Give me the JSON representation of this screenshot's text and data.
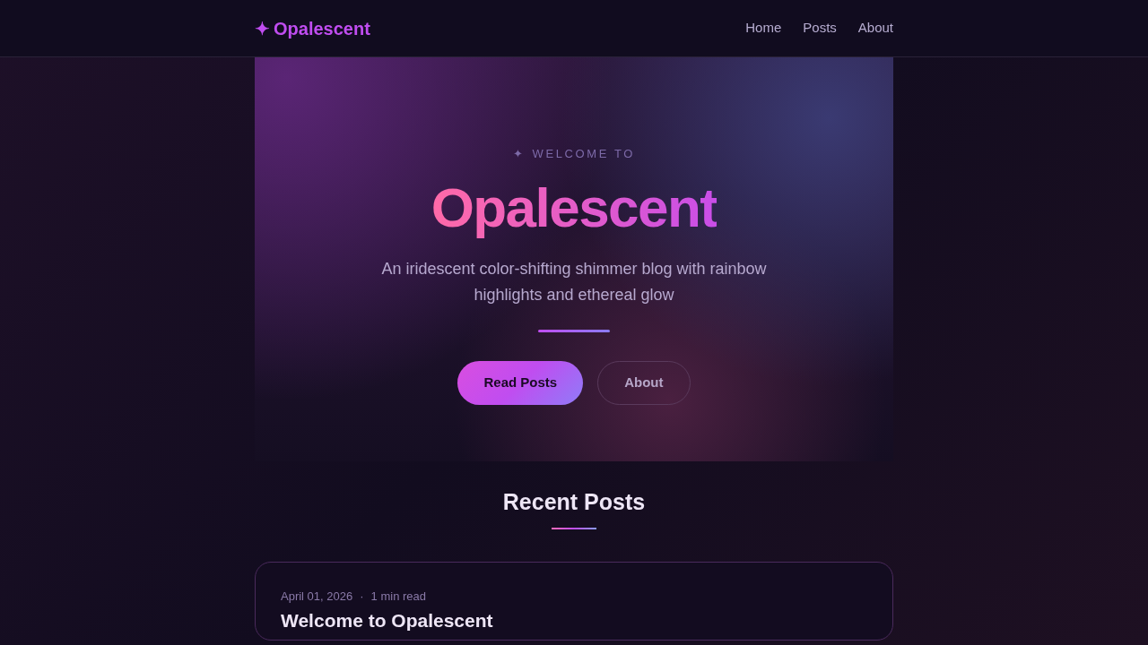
{
  "header": {
    "logo_icon": "✦",
    "logo": "Opalescent",
    "nav": [
      {
        "label": "Home"
      },
      {
        "label": "Posts"
      },
      {
        "label": "About"
      }
    ]
  },
  "hero": {
    "eyebrow_icon": "✦",
    "eyebrow": "WELCOME TO",
    "title": "Opalescent",
    "subtitle": "An iridescent color-shifting shimmer blog with rainbow highlights and ethereal glow",
    "buttons": [
      {
        "label": "Read Posts",
        "kind": "primary"
      },
      {
        "label": "About",
        "kind": "outline"
      }
    ]
  },
  "recent": {
    "heading": "Recent Posts",
    "posts": [
      {
        "date": "April 01, 2026",
        "separator": "·",
        "read_time": "1 min read",
        "title": "Welcome to Opalescent"
      }
    ]
  }
}
